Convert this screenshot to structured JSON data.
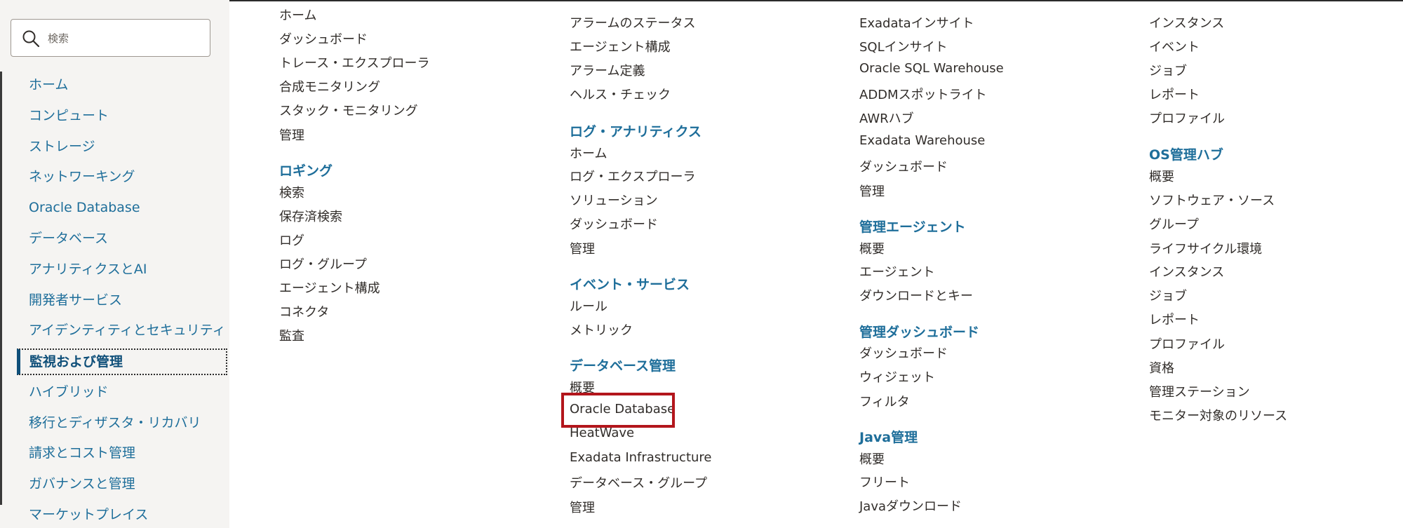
{
  "search": {
    "placeholder": "検索"
  },
  "sidebar": {
    "items": [
      {
        "label": "ホーム"
      },
      {
        "label": "コンピュート"
      },
      {
        "label": "ストレージ"
      },
      {
        "label": "ネットワーキング"
      },
      {
        "label": "Oracle Database"
      },
      {
        "label": "データベース"
      },
      {
        "label": "アナリティクスとAI"
      },
      {
        "label": "開発者サービス"
      },
      {
        "label": "アイデンティティとセキュリティ"
      },
      {
        "label": "監視および管理",
        "active": true
      },
      {
        "label": "ハイブリッド"
      },
      {
        "label": "移行とディザスタ・リカバリ"
      },
      {
        "label": "請求とコスト管理"
      },
      {
        "label": "ガバナンスと管理"
      },
      {
        "label": "マーケットプレイス"
      }
    ]
  },
  "columns": {
    "col1": {
      "group1": {
        "links": [
          "ホーム",
          "ダッシュボード",
          "トレース・エクスプローラ",
          "合成モニタリング",
          "スタック・モニタリング",
          "管理"
        ]
      },
      "logging": {
        "heading": "ロギング",
        "links": [
          "検索",
          "保存済検索",
          "ログ",
          "ログ・グループ",
          "エージェント構成",
          "コネクタ",
          "監査"
        ]
      }
    },
    "col2": {
      "group1": {
        "links": [
          "アラームのステータス",
          "エージェント構成",
          "アラーム定義",
          "ヘルス・チェック"
        ]
      },
      "log_analytics": {
        "heading": "ログ・アナリティクス",
        "links": [
          "ホーム",
          "ログ・エクスプローラ",
          "ソリューション",
          "ダッシュボード",
          "管理"
        ]
      },
      "events": {
        "heading": "イベント・サービス",
        "links": [
          "ルール",
          "メトリック"
        ]
      },
      "db_mgmt": {
        "heading": "データベース管理",
        "links": [
          "概要",
          "Oracle Database",
          "HeatWave",
          "Exadata Infrastructure",
          "データベース・グループ",
          "管理"
        ]
      }
    },
    "col3": {
      "group1": {
        "links": [
          "Exadataインサイト",
          "SQLインサイト",
          "Oracle SQL Warehouse",
          "ADDMスポットライト",
          "AWRハブ",
          "Exadata Warehouse",
          "ダッシュボード",
          "管理"
        ]
      },
      "mgmt_agent": {
        "heading": "管理エージェント",
        "links": [
          "概要",
          "エージェント",
          "ダウンロードとキー"
        ]
      },
      "mgmt_dash": {
        "heading": "管理ダッシュボード",
        "links": [
          "ダッシュボード",
          "ウィジェット",
          "フィルタ"
        ]
      },
      "java_mgmt": {
        "heading": "Java管理",
        "links": [
          "概要",
          "フリート",
          "Javaダウンロード"
        ]
      }
    },
    "col4": {
      "group1": {
        "links": [
          "インスタンス",
          "イベント",
          "ジョブ",
          "レポート",
          "プロファイル"
        ]
      },
      "os_hub": {
        "heading": "OS管理ハブ",
        "links": [
          "概要",
          "ソフトウェア・ソース",
          "グループ",
          "ライフサイクル環境",
          "インスタンス",
          "ジョブ",
          "レポート",
          "プロファイル",
          "資格",
          "管理ステーション",
          "モニター対象のリソース"
        ]
      }
    }
  },
  "colors": {
    "accent": "#1e6e9a",
    "highlight": "#b3161c",
    "sidebar_bg": "#f5f4f2"
  }
}
